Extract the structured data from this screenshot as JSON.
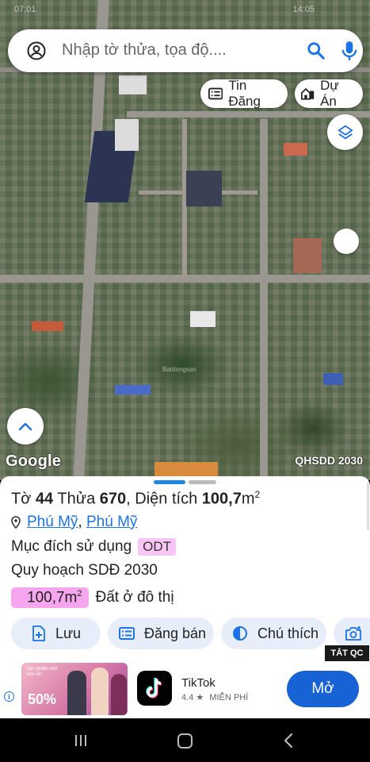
{
  "status_bar": {
    "left_text": "07:01",
    "right_text": "14:05"
  },
  "search": {
    "placeholder": "Nhập tờ thửa, tọa độ...."
  },
  "map": {
    "chips": {
      "tin_dang": "Tin Đăng",
      "du_an": "Dự Án"
    },
    "google_logo": "Google",
    "layer_label": "QHSDD 2030",
    "watermark": "Batdongsan"
  },
  "parcel": {
    "to_label": "Tờ",
    "to_value": "44",
    "thua_label": "Thửa",
    "thua_value": "670",
    "area_label": ", Diện tích",
    "area_value": "100,7",
    "area_unit": "m",
    "area_sup": "2",
    "ward": "Phú Mỹ",
    "separator": ", ",
    "district": "Phú Mỹ",
    "purpose_label": "Mục đích sử dụng",
    "purpose_code": "ODT",
    "plan_label": "Quy hoạch SDĐ 2030",
    "plan_area": "100,7m",
    "plan_area_sup": "2",
    "plan_use": "Đất ở đô thị"
  },
  "actions": {
    "save": "Lưu",
    "post_sale": "Đăng bán",
    "legend": "Chú thích"
  },
  "ad": {
    "close_tag": "TẮT QC",
    "banner_line1": "Sản phẩm mới vừa về!",
    "banner_discount": "50%",
    "app_name": "TikTok",
    "rating": "4.4",
    "star": "★",
    "price": "MIỄN PHÍ",
    "open_label": "Mở",
    "info": "i"
  },
  "colors": {
    "accent_blue": "#1a73e8",
    "odt_badge": "#f7c6f5",
    "area_chip": "#f6a6ef",
    "action_bg": "#e8eef9",
    "open_button": "#1763d6"
  }
}
